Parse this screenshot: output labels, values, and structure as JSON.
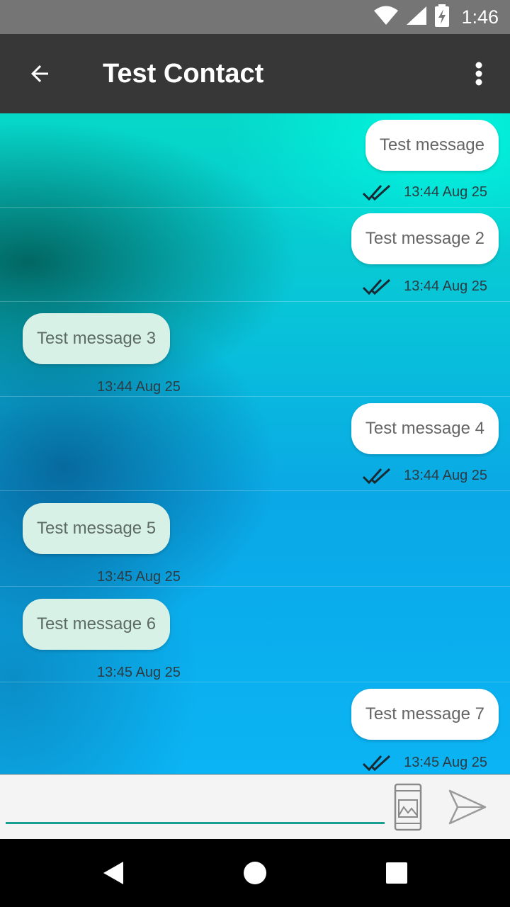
{
  "status_bar": {
    "time": "1:46",
    "icons": [
      "wifi-icon",
      "signal-icon",
      "battery-charging-icon"
    ]
  },
  "app_bar": {
    "title": "Test Contact",
    "back_icon": "arrow-back-icon",
    "menu_icon": "more-vert-icon"
  },
  "messages": [
    {
      "text": "Test message",
      "time": "13:44 Aug 25",
      "direction": "outgoing",
      "status_icon": "double-check-icon"
    },
    {
      "text": "Test message 2",
      "time": "13:44 Aug 25",
      "direction": "outgoing",
      "status_icon": "double-check-icon"
    },
    {
      "text": "Test message 3",
      "time": "13:44 Aug 25",
      "direction": "incoming"
    },
    {
      "text": "Test message 4",
      "time": "13:44 Aug 25",
      "direction": "outgoing",
      "status_icon": "double-check-icon"
    },
    {
      "text": "Test message 5",
      "time": "13:45 Aug 25",
      "direction": "incoming"
    },
    {
      "text": "Test message 6",
      "time": "13:45 Aug 25",
      "direction": "incoming"
    },
    {
      "text": "Test message 7",
      "time": "13:45 Aug 25",
      "direction": "outgoing",
      "status_icon": "double-check-icon"
    }
  ],
  "composer": {
    "input_value": "",
    "attach_icon": "image-attach-icon",
    "send_icon": "send-icon"
  },
  "nav_bar": {
    "icons": [
      "nav-back-icon",
      "nav-home-icon",
      "nav-recents-icon"
    ]
  },
  "colors": {
    "app_bar": "#373737",
    "status_bar": "#757575",
    "incoming_bubble": "#d7f1e6",
    "outgoing_bubble": "#ffffff",
    "input_underline": "#17a091"
  }
}
